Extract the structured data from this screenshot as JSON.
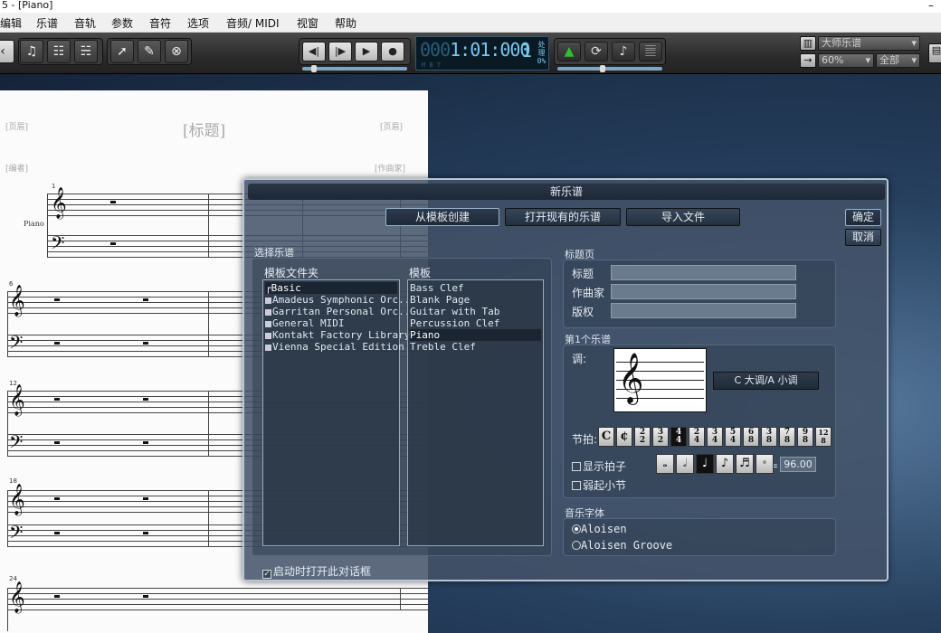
{
  "window": {
    "title": "5 - [Piano]",
    "minimize": "–"
  },
  "menu": [
    "编辑",
    "乐谱",
    "音轨",
    "参数",
    "音符",
    "选项",
    "音频/ MIDI",
    "视窗",
    "帮助"
  ],
  "toolbar": {
    "left_icons": [
      "back-icon",
      "note-icon",
      "mixer-icon",
      "mixer-alt-icon",
      "select-arrow-icon",
      "pencil-icon",
      "cancel-icon"
    ],
    "transport_icons": [
      "rewind-icon",
      "play-from-start-icon",
      "play-icon",
      "record-icon"
    ],
    "right_icons": [
      "metronome-icon",
      "loop-icon",
      "note-input-icon",
      "staff-icon"
    ]
  },
  "lcd": {
    "time_dim": "000",
    "time": "1:01:000",
    "bar": "1",
    "status_line1": "处理",
    "status_line2": "0%",
    "labels": "M      B      T"
  },
  "right_controls": {
    "top_select": "大师乐谱",
    "zoom": "60%",
    "scope": "全部"
  },
  "score": {
    "title_placeholder": "[标题]",
    "subtitle_left": "[页眉]",
    "subtitle_right": "[页眉]",
    "composer_left": "[编者]",
    "composer_right": "[作曲家]",
    "instrument": "Piano",
    "measure_numbers": [
      "1",
      "6",
      "12",
      "18",
      "24"
    ]
  },
  "dialog": {
    "title": "新乐谱",
    "tabs": [
      "从模板创建",
      "打开现有的乐谱",
      "导入文件"
    ],
    "ok": "确定",
    "cancel": "取消",
    "choose_score_label": "选择乐谱",
    "folders_header": "模板文件夹",
    "folders": [
      "Basic",
      "Amadeus Symphonic Orc...",
      "Garritan Personal Orc...",
      "General MIDI",
      "Kontakt Factory Library",
      "Vienna Special Edition"
    ],
    "templates_header": "模板",
    "templates": [
      "Bass Clef",
      "Blank Page",
      "Guitar with Tab",
      "Percussion Clef",
      "Piano",
      "Treble Clef"
    ],
    "selected_template": "Piano",
    "title_page_label": "标题页",
    "fields": [
      {
        "label": "标题",
        "value": ""
      },
      {
        "label": "作曲家",
        "value": ""
      },
      {
        "label": "版权",
        "value": ""
      }
    ],
    "first_score_label": "第1个乐谱",
    "key_label": "调:",
    "key_value": "C 大调/A 小调",
    "time_sig_label": "节拍:",
    "time_sigs": [
      "C",
      "¢",
      "2/2",
      "3/2",
      "4/4",
      "2/4",
      "3/4",
      "5/4",
      "6/8",
      "3/8",
      "7/8",
      "9/8",
      "12/8"
    ],
    "selected_time_sig": "4/4",
    "show_beat_label": "显示拍子",
    "pickup_label": "弱起小节",
    "beat_equals": "=",
    "tempo": "96.00",
    "font_label": "音乐字体",
    "fonts": [
      "Aloisen",
      "Aloisen Groove"
    ],
    "selected_font": "Aloisen",
    "startup_checkbox": "启动时打开此对话框"
  }
}
